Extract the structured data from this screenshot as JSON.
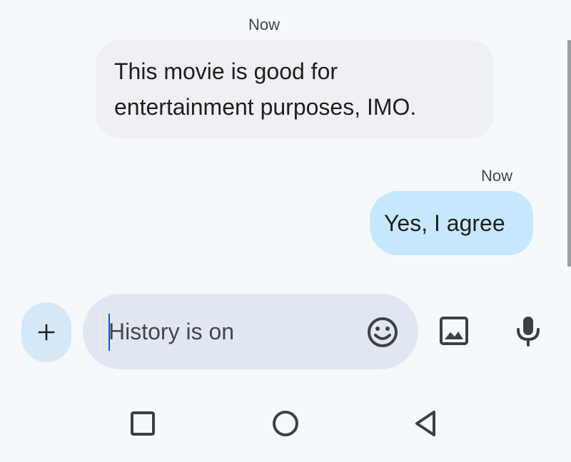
{
  "messages": [
    {
      "direction": "incoming",
      "timestamp": "Now",
      "lines": [
        "This movie is good for",
        "entertainment purposes, IMO."
      ]
    },
    {
      "direction": "outgoing",
      "timestamp": "Now",
      "text": "Yes, I agree"
    }
  ],
  "composer": {
    "placeholder": "History is on",
    "add_label": "+",
    "icons": {
      "add": "plus-icon",
      "emoji": "emoji-icon",
      "gallery": "image-icon",
      "voice": "mic-icon"
    }
  },
  "navigation": {
    "icons": [
      "recents-square-icon",
      "home-circle-icon",
      "back-triangle-icon"
    ]
  },
  "colors": {
    "background": "#f5f9fc",
    "incoming_bubble": "#eff0f3",
    "outgoing_bubble": "#c6e7fd",
    "compose_field": "#e1e7f0",
    "add_button": "#d4e8f8",
    "caret": "#0b57d0"
  }
}
